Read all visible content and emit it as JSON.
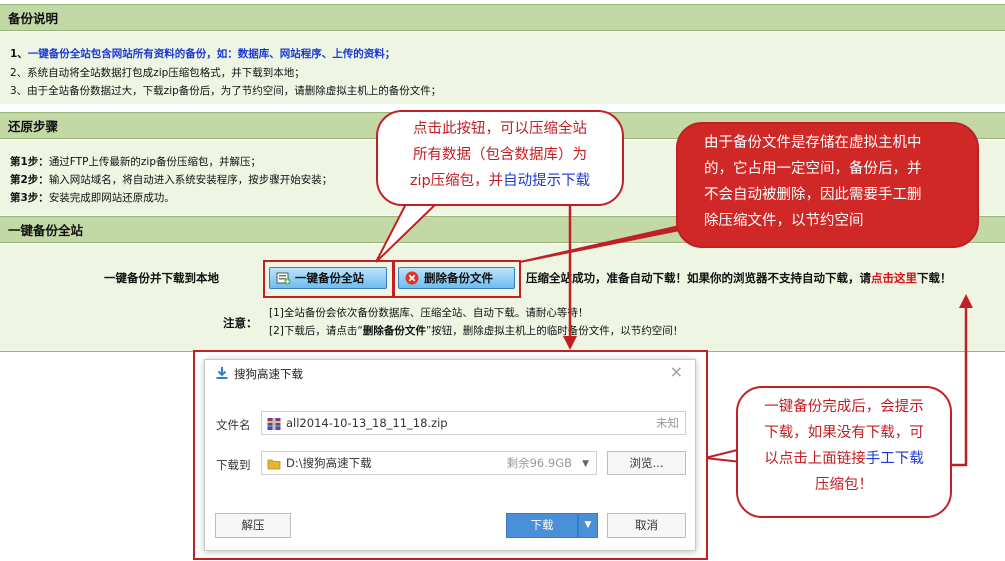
{
  "section1": {
    "title": "备份说明",
    "line1_prefix": "1、",
    "line1_blue": "一键备份全站包含网站所有资料的备份，如：数据库、网站程序、上传的资料；",
    "line2": "2、系统自动将全站数据打包成zip压缩包格式，并下载到本地；",
    "line3": "3、由于全站备份数据过大，下载zip备份后，为了节约空间，请删除虚拟主机上的备份文件；"
  },
  "section2": {
    "title": "还原步骤",
    "steps": [
      {
        "label": "第1步：",
        "text": "通过FTP上传最新的zip备份压缩包，并解压；"
      },
      {
        "label": "第2步：",
        "text": "输入网站域名，将自动进入系统安装程序，按步骤开始安装；"
      },
      {
        "label": "第3步：",
        "text": "安装完成即网站还原成功。"
      }
    ]
  },
  "section3": {
    "title": "一键备份全站",
    "row_label": "一键备份并下载到本地",
    "backup_button": "一键备份全站",
    "delete_button": "删除备份文件",
    "status_prefix": "压缩全站成功，准备自动下载！如果你的浏览器不支持自动下载，请",
    "status_link": "点击这里",
    "status_suffix": "下载！",
    "note_label": "注意：",
    "note1": "[1]全站备份会依次备份数据库、压缩全站、自动下载。请耐心等待！",
    "note2_prefix": "[2]下载后，请点击“",
    "note2_bold": "删除备份文件",
    "note2_suffix": "”按钮，删除虚拟主机上的临时备份文件，以节约空间！"
  },
  "callouts": {
    "c1_line1": "点击此按钮，可以压缩全站",
    "c1_line2": "所有数据（包含数据库）为",
    "c1_line3a": "zip压缩包，并",
    "c1_line3b": "自动提示下载",
    "c2_line1": "由于备份文件是存储在虚拟主机中",
    "c2_line2": "的，它占用一定空间，备份后，并",
    "c2_line3": "不会自动被删除，因此需要手工删",
    "c2_line4": "除压缩文件，以节约空间",
    "c3_line1": "一键备份完成后，会提示",
    "c3_line2": "下载，如果没有下载，可",
    "c3_line3a": "以点击上面链接",
    "c3_line3b": "手工下载",
    "c3_line4": "压缩包！"
  },
  "dialog": {
    "title": "搜狗高速下载",
    "filename_label": "文件名",
    "filename_value": "all2014-10-13_18_11_18.zip",
    "filesize": "未知",
    "saveto_label": "下载到",
    "saveto_value": "D:\\搜狗高速下载",
    "free_space": "剩余96.9GB",
    "browse_button": "浏览...",
    "extract_button": "解压",
    "download_button": "下载",
    "cancel_button": "取消"
  },
  "colors": {
    "header_bg": "#c3d9a5",
    "body_bg": "#eef5e3",
    "accent_red": "#c02025",
    "link_blue": "#1d3bd1",
    "dialog_blue": "#4a90d9"
  }
}
